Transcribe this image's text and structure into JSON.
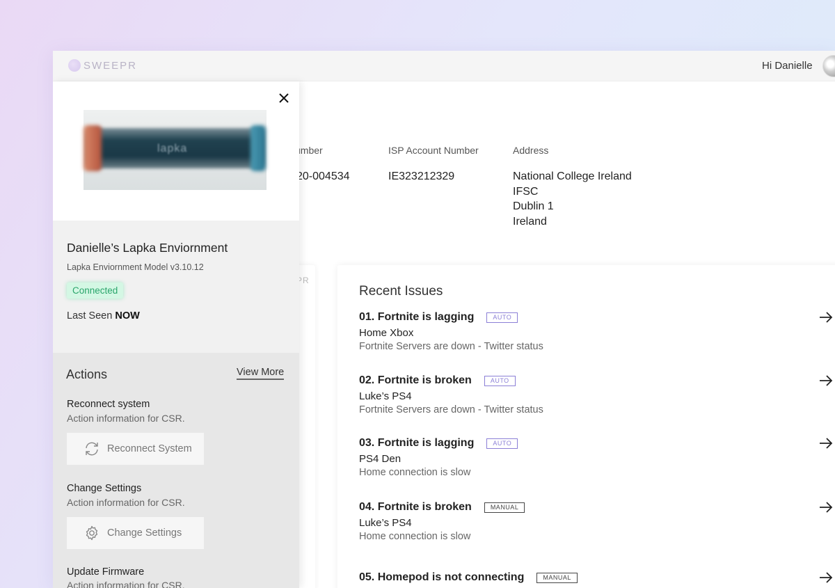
{
  "app": {
    "logo_text": "SWEEPR",
    "greeting": "Hi Danielle"
  },
  "account": {
    "labels": {
      "number_fragment": "umber",
      "isp": "ISP Account Number",
      "address": "Address"
    },
    "values": {
      "number_fragment": "20-004534",
      "isp": "IE323212329",
      "address_lines": [
        "National College Ireland",
        "IFSC",
        "Dublin 1",
        "Ireland"
      ]
    }
  },
  "left_card_fragment": "PR",
  "issues": {
    "title": "Recent Issues",
    "items": [
      {
        "title": "01.  Fortnite is lagging",
        "badge": "AUTO",
        "device": "Home Xbox",
        "desc": "Fortnite Servers are down - Twitter status"
      },
      {
        "title": "02. Fortnite is broken",
        "badge": "AUTO",
        "device": "Luke’s PS4",
        "desc": "Fortnite Servers are down - Twitter status"
      },
      {
        "title": "03. Fortnite is lagging",
        "badge": "AUTO",
        "device": "PS4 Den",
        "desc": "Home connection is slow"
      },
      {
        "title": "04. Fortnite is broken",
        "badge": "MANUAL",
        "device": "Luke’s PS4",
        "desc": "Home connection is slow"
      },
      {
        "title": "05. Homepod is not connecting",
        "badge": "MANUAL",
        "device": "",
        "desc": ""
      }
    ]
  },
  "panel": {
    "device_image_label": "lapka",
    "device_name": "Danielle’s Lapka Enviornment",
    "device_model": "Lapka Enviornment Model v3.10.12",
    "status": "Connected",
    "last_seen_label": "Last Seen",
    "last_seen_value": "NOW",
    "actions_title": "Actions",
    "view_more": "View More",
    "actions": [
      {
        "name": "Reconnect system",
        "info": "Action information for CSR.",
        "button": "Reconnect System",
        "icon": "refresh-icon"
      },
      {
        "name": "Change Settings",
        "info": "Action information for CSR.",
        "button": "Change Settings",
        "icon": "gear-icon"
      },
      {
        "name": "Update Firmware",
        "info": "Action information for CSR.",
        "button": "",
        "icon": ""
      }
    ]
  },
  "colors": {
    "accent": "#8b7fd6",
    "status_bg": "#d4f7e4",
    "status_text": "#2aa56b"
  }
}
